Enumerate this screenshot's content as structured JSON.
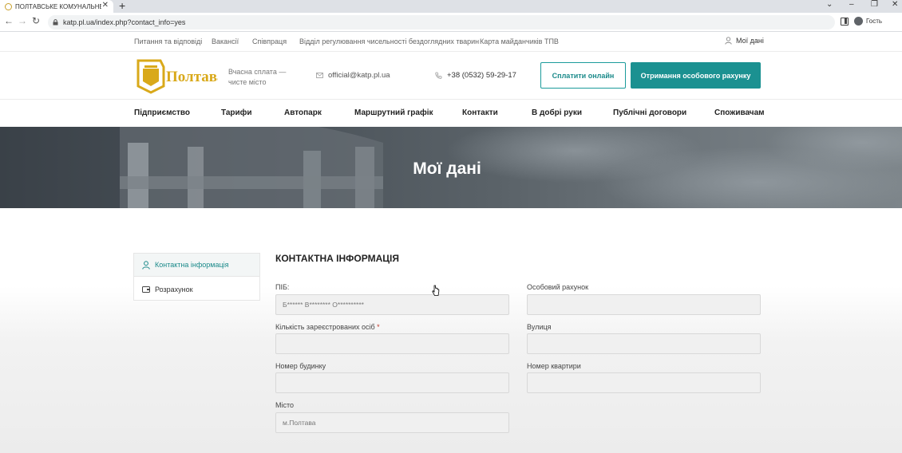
{
  "browser": {
    "tab_title": "ПОЛТАВСЬКЕ КОМУНАЛЬНЕ АТ",
    "url": "katp.pl.ua/index.php?contact_info=yes",
    "profile_label": "Гость"
  },
  "topbar": {
    "links": [
      "Питання та відповіді",
      "Вакансії",
      "Співпраця",
      "Відділ регулювання чисельності бездоглядних тварин",
      "Карта майданчиків ТПВ"
    ],
    "my_data": "Мої дані"
  },
  "header": {
    "logo_text": "Полтава",
    "tagline": "Вчасна сплата — чисте місто",
    "email": "official@katp.pl.ua",
    "phone": "+38 (0532) 59-29-17",
    "pay_online": "Сплатити онлайн",
    "get_account": "Отримання особового рахунку",
    "accent_color": "#1b9191"
  },
  "nav": [
    "Підприємство",
    "Тарифи",
    "Автопарк",
    "Маршрутний графік",
    "Контакти",
    "В добрі руки",
    "Публічні договори",
    "Споживачам"
  ],
  "hero": {
    "title": "Мої дані"
  },
  "sidebar": {
    "items": [
      {
        "label": "Контактна інформація",
        "icon": "user-icon"
      },
      {
        "label": "Розрахунок",
        "icon": "wallet-icon"
      }
    ]
  },
  "form": {
    "title": "КОНТАКТНА ІНФОРМАЦІЯ",
    "fields": {
      "pib": {
        "label": "ПІБ:",
        "value": "Б****** В******** О**********"
      },
      "account": {
        "label": "Особовий рахунок",
        "value": ""
      },
      "people": {
        "label": "Кількість зареєстрованих осіб",
        "required": "*",
        "value": ""
      },
      "street": {
        "label": "Вулиця",
        "value": ""
      },
      "house": {
        "label": "Номер будинку",
        "value": ""
      },
      "apartment": {
        "label": "Номер квартири",
        "value": ""
      },
      "city": {
        "label": "Місто",
        "value": "м.Полтава"
      }
    }
  }
}
